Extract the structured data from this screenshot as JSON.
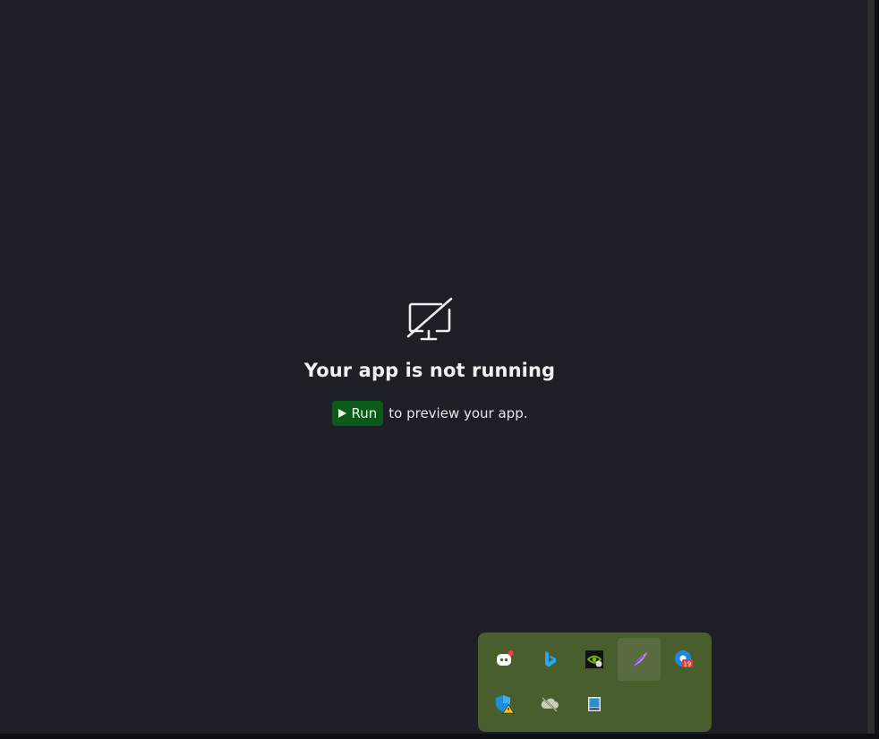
{
  "preview": {
    "title": "Your app is not running",
    "run_label": "Run",
    "hint": "to preview your app.",
    "icon": "monitor-off-icon"
  },
  "tray": {
    "icons": [
      {
        "name": "discord-icon"
      },
      {
        "name": "bing-icon"
      },
      {
        "name": "nvidia-icon"
      },
      {
        "name": "feather-icon"
      },
      {
        "name": "chrome-icon",
        "badge": "19"
      },
      {
        "name": "defender-icon"
      },
      {
        "name": "onedrive-icon"
      },
      {
        "name": "display-icon"
      }
    ]
  },
  "colors": {
    "background": "#1c1f26",
    "run_button": "#0a5a1a",
    "tray_background": "#4a5d2d"
  }
}
